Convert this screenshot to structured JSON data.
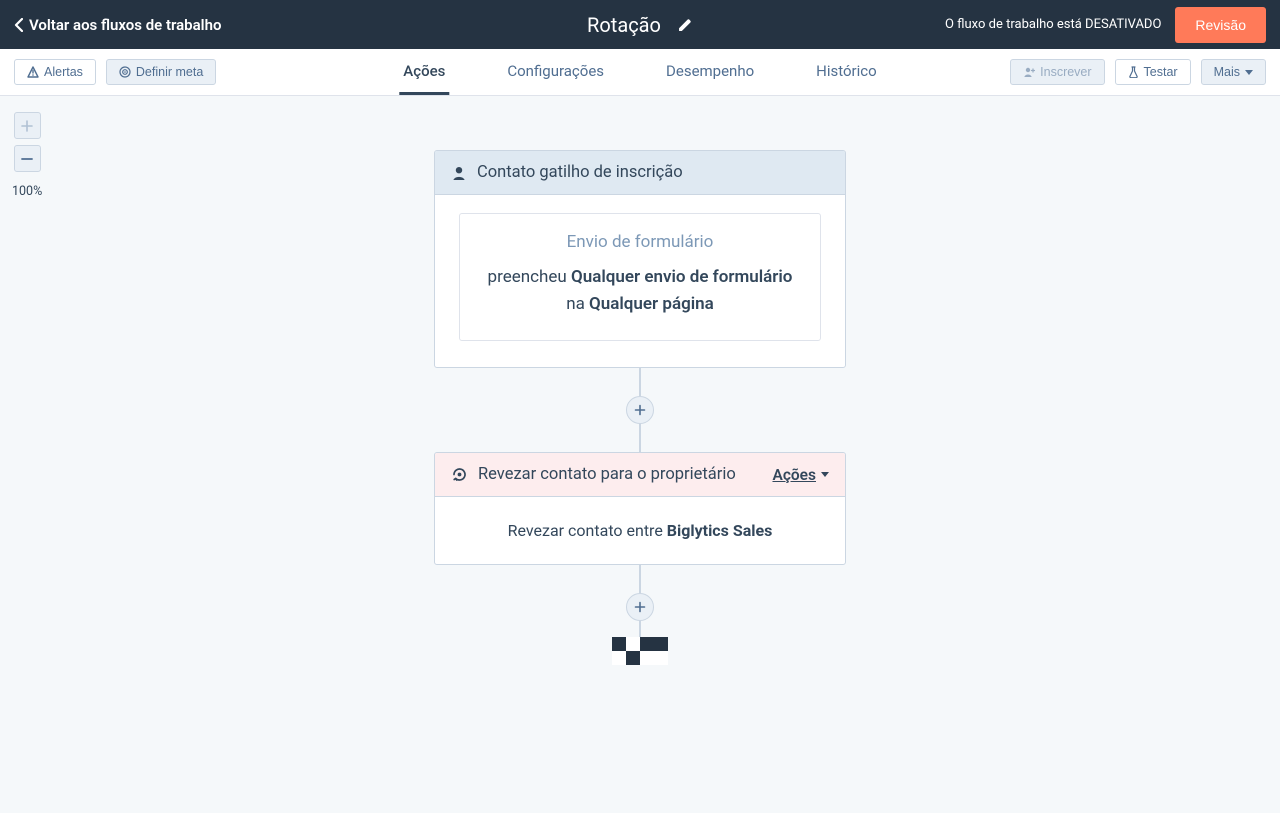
{
  "topbar": {
    "back_label": "Voltar aos fluxos de trabalho",
    "title": "Rotação",
    "status_text": "O fluxo de trabalho está DESATIVADO",
    "review_button": "Revisão"
  },
  "subbar": {
    "alerts_button": "Alertas",
    "goal_button": "Definir meta",
    "tabs": {
      "actions": "Ações",
      "settings": "Configurações",
      "performance": "Desempenho",
      "history": "Histórico"
    },
    "enroll_button": "Inscrever",
    "test_button": "Testar",
    "more_button": "Mais"
  },
  "zoom": {
    "level_label": "100%"
  },
  "trigger_card": {
    "header": "Contato gatilho de inscrição",
    "inner_title": "Envio de formulário",
    "desc_prefix": "preencheu ",
    "desc_bold1": "Qualquer envio de formulário",
    "desc_mid": " na ",
    "desc_bold2": "Qualquer página"
  },
  "action_card": {
    "header": "Revezar contato para o proprietário",
    "actions_link": "Ações",
    "body_prefix": "Revezar contato entre ",
    "body_bold": "Biglytics Sales"
  }
}
